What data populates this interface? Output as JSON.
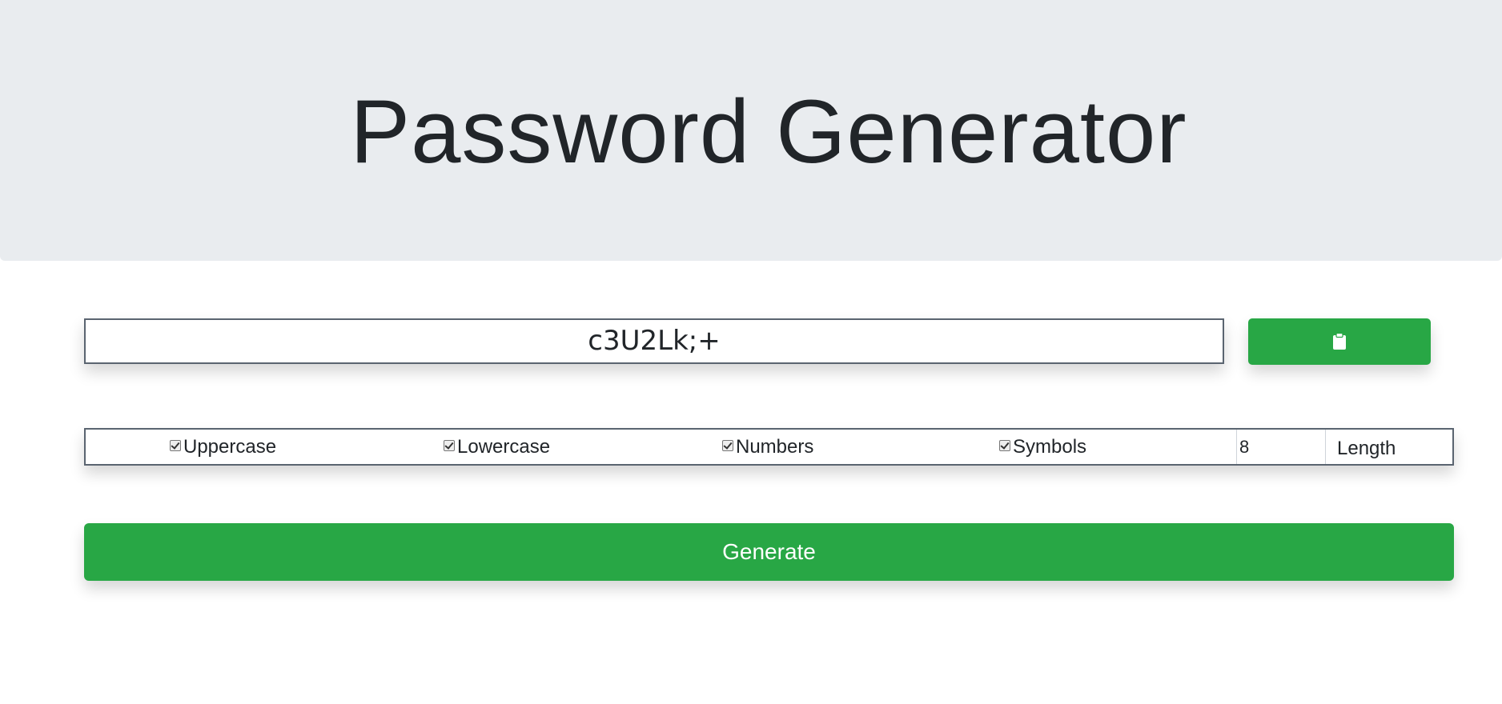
{
  "header": {
    "title": "Password Generator"
  },
  "output": {
    "password": "c3U2Lk;+"
  },
  "copy_button": {
    "icon": "clipboard-icon"
  },
  "options": [
    {
      "label": "Uppercase",
      "checked": true
    },
    {
      "label": "Lowercase",
      "checked": true
    },
    {
      "label": "Numbers",
      "checked": true
    },
    {
      "label": "Symbols",
      "checked": true
    }
  ],
  "length": {
    "value": "8",
    "label": "Length"
  },
  "generate_button": {
    "label": "Generate"
  },
  "colors": {
    "accent": "#28a745",
    "jumbotron": "#e9ecef",
    "text": "#212529"
  }
}
